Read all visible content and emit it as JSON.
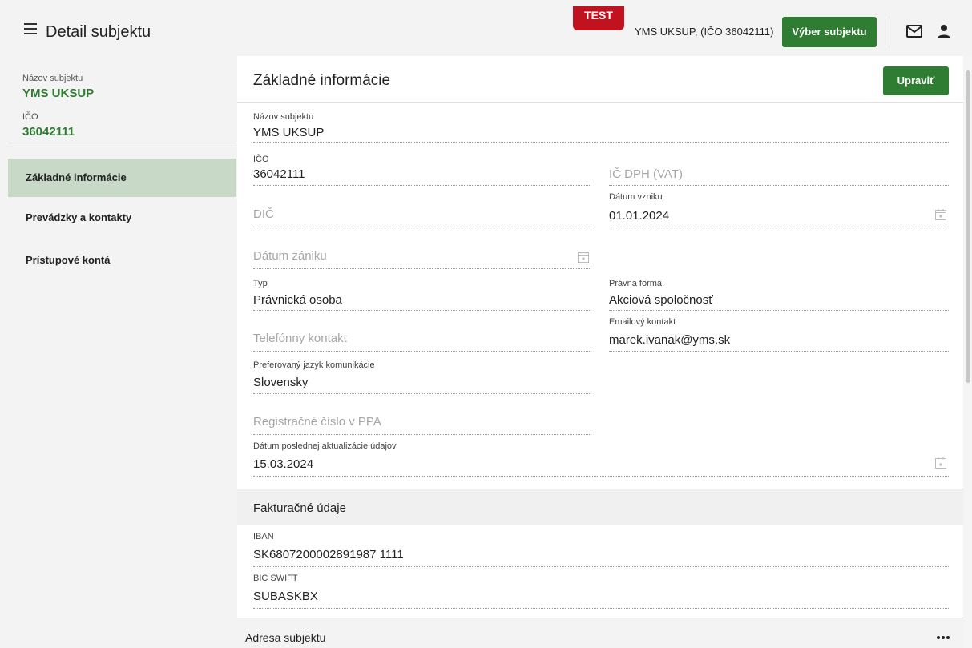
{
  "header": {
    "title": "Detail subjektu",
    "test_badge": "TEST",
    "subject": "YMS UKSUP, (IČO 36042111)",
    "select_button": "Výber subjektu"
  },
  "sidebar": {
    "name_label": "Názov subjektu",
    "name_value": "YMS UKSUP",
    "ico_label": "IČO",
    "ico_value": "36042111",
    "items": [
      {
        "label": "Základné informácie",
        "active": true
      },
      {
        "label": "Prevádzky a kontakty",
        "active": false
      },
      {
        "label": "Prístupové kontá",
        "active": false
      }
    ]
  },
  "main": {
    "title": "Základné informácie",
    "edit_button": "Upraviť",
    "fields": {
      "name": {
        "label": "Názov subjektu",
        "value": "YMS UKSUP"
      },
      "ico": {
        "label": "IČO",
        "value": "36042111"
      },
      "vat": {
        "placeholder": "IČ DPH (VAT)"
      },
      "created": {
        "label": "Dátum vzniku",
        "value": "01.01.2024"
      },
      "dic": {
        "placeholder": "DIČ"
      },
      "ended": {
        "placeholder": "Dátum zániku"
      },
      "type": {
        "label": "Typ",
        "value": "Právnická osoba"
      },
      "legal_form": {
        "label": "Právna forma",
        "value": "Akciová spoločnosť"
      },
      "phone": {
        "placeholder": "Telefónny kontakt"
      },
      "email": {
        "label": "Emailový kontakt",
        "value": "marek.ivanak@yms.sk"
      },
      "language": {
        "label": "Preferovaný jazyk komunikácie",
        "value": "Slovensky"
      },
      "ppa": {
        "placeholder": "Registračné číslo v PPA"
      },
      "updated": {
        "label": "Dátum poslednej aktualizácie údajov",
        "value": "15.03.2024"
      }
    },
    "billing": {
      "title": "Fakturačné údaje",
      "iban": {
        "label": "IBAN",
        "value": "SK6807200002891987 1111"
      },
      "bic": {
        "label": "BIC SWIFT",
        "value": "SUBASKBX"
      }
    },
    "address": {
      "title": "Adresa subjektu"
    }
  },
  "colors": {
    "accent": "#2e7d32",
    "badge": "#c1121f",
    "active_nav": "#c8d9c8"
  }
}
